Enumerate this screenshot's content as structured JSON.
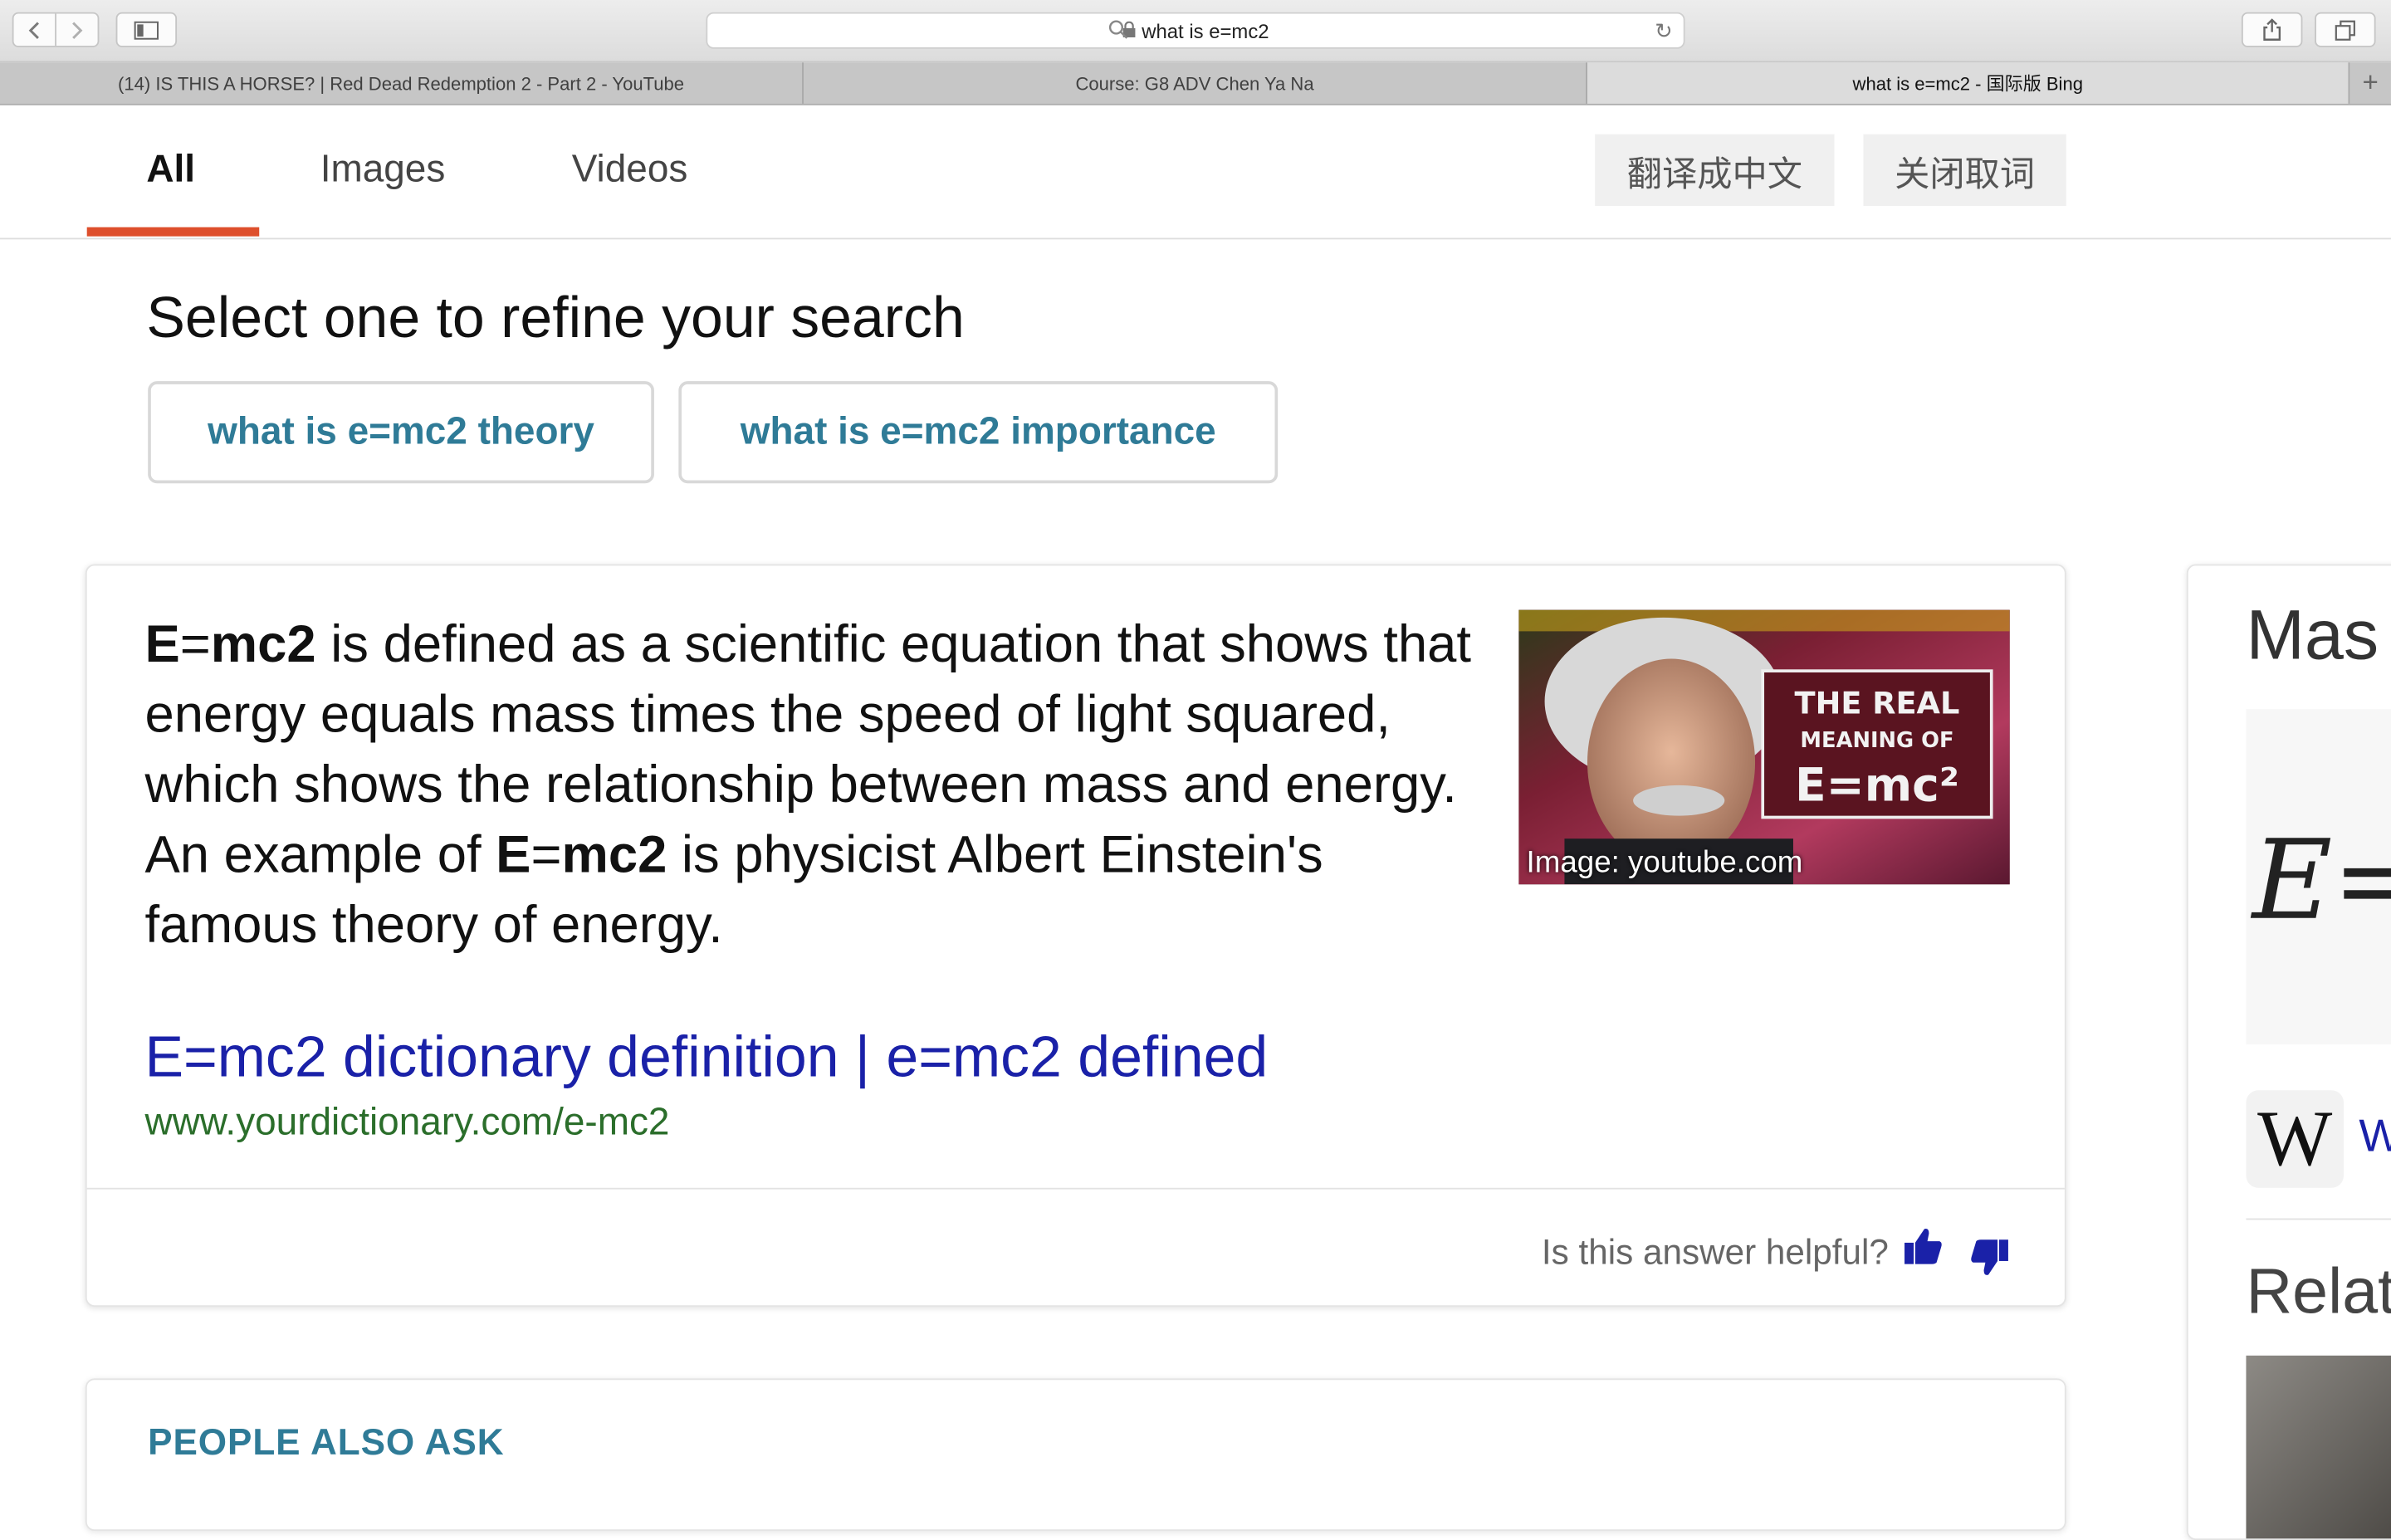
{
  "browser": {
    "url_text": "what is e=mc2",
    "tabs": [
      {
        "label": "(14) IS THIS A HORSE? | Red Dead Redemption 2 - Part 2 - YouTube"
      },
      {
        "label": "Course: G8 ADV Chen Ya Na"
      },
      {
        "label": "what is e=mc2 - 国际版 Bing"
      }
    ],
    "new_tab_glyph": "+"
  },
  "nav": {
    "items": [
      {
        "label": "All"
      },
      {
        "label": "Images"
      },
      {
        "label": "Videos"
      }
    ],
    "translate_label": "翻译成中文",
    "close_lookup_label": "关闭取词",
    "active_color": "#de4f2c"
  },
  "refine": {
    "title": "Select one to refine your search",
    "chips": [
      {
        "label": "what is e=mc2 theory"
      },
      {
        "label": "what is e=mc2 importance"
      }
    ]
  },
  "answer": {
    "term1": "E",
    "eq1": "=",
    "term1b": "mc2",
    "text1": " is defined as a scientific equation that shows that energy equals mass times the speed of light squared, which shows the relationship between mass and energy. An example of ",
    "term2": "E",
    "eq2": "=",
    "term2b": "mc2",
    "text2": " is physicist Albert Einstein's famous theory of energy.",
    "image_caption": "Image: youtube.com",
    "image_text_line1": "THE REAL",
    "image_text_line2": "MEANING OF",
    "image_text_line3": "E=mc²",
    "source_title": "E=mc2 dictionary definition | e=mc2 defined",
    "source_url": "www.yourdictionary.com/e-mc2",
    "helpful_text": "Is this answer helpful?"
  },
  "people_also_ask": {
    "heading": "PEOPLE ALSO ASK"
  },
  "side_panel": {
    "title": "Mas",
    "formula": "E=",
    "wiki_logo": "W",
    "wiki_link": "W",
    "related": "Relat"
  },
  "colors": {
    "link_blue": "#1a21a8",
    "url_green": "#2b6e2b",
    "chip_teal": "#2f7b97"
  }
}
